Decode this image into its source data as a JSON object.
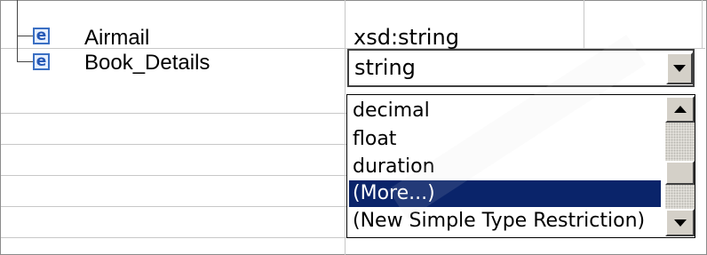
{
  "rows": [
    {
      "icon_label": "e",
      "name": "Airmail",
      "type": "xsd:string"
    },
    {
      "icon_label": "e",
      "name": "Book_Details",
      "type": "string"
    }
  ],
  "dropdown": {
    "selected_value": "string",
    "options": [
      "decimal",
      "float",
      "duration",
      "(More...)",
      "(New Simple Type Restriction)"
    ],
    "highlighted_option": "(More...)"
  },
  "colors": {
    "selection_background": "#0a246a",
    "element_icon": "#3a6fc3",
    "button_face": "#d4d0c8"
  },
  "icons": [
    "element-icon",
    "dropdown-arrow-icon",
    "scroll-up-arrow-icon",
    "scroll-down-arrow-icon"
  ]
}
